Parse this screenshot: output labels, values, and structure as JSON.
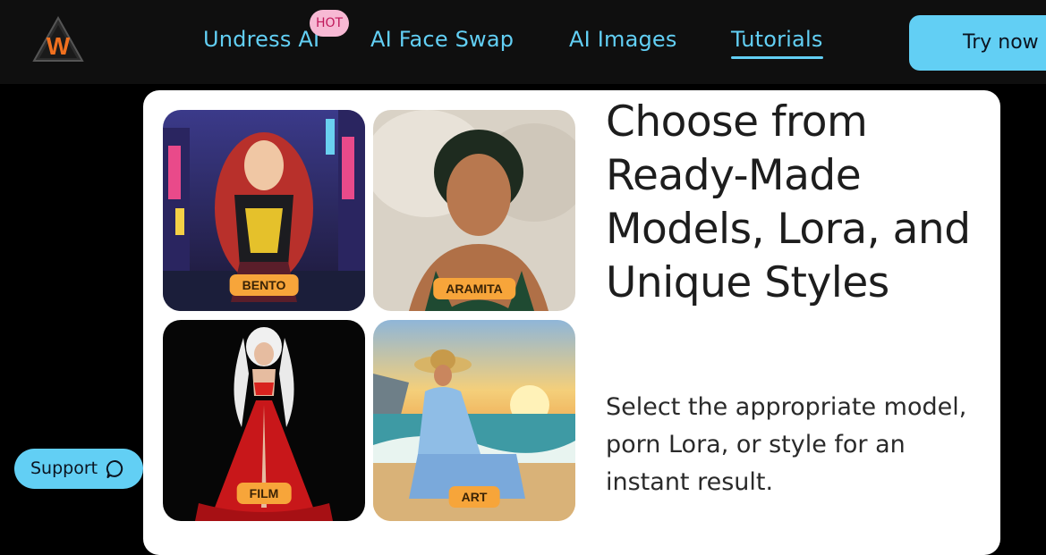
{
  "header": {
    "logo_icon": "w-triangle-logo",
    "nav": [
      {
        "label": "Undress AI",
        "badge": "HOT"
      },
      {
        "label": "AI Face Swap"
      },
      {
        "label": "AI Images"
      },
      {
        "label": "Tutorials",
        "active": true
      }
    ],
    "cta_label": "Try now"
  },
  "section": {
    "heading": "Choose from Ready-Made Models, Lora, and Unique Styles",
    "description": "Select the appropriate model, porn Lora, or style for an instant result.",
    "tiles": [
      {
        "label": "BENTO"
      },
      {
        "label": "ARAMITA"
      },
      {
        "label": "FILM"
      },
      {
        "label": "ART"
      }
    ]
  },
  "support": {
    "label": "Support",
    "icon": "chat-bubble-icon"
  },
  "colors": {
    "accent": "#62cff4",
    "tile_label_bg": "#f7a53a",
    "hot_badge_bg": "#f7b9d4"
  }
}
